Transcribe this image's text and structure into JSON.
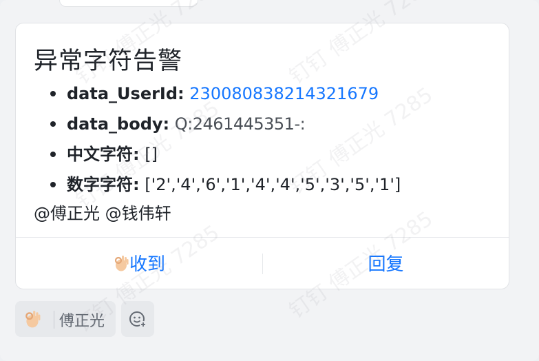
{
  "card": {
    "title": "异常字符告警",
    "fields": [
      {
        "key": "data_UserId:",
        "value": "230080838214321679",
        "style": "link"
      },
      {
        "key": "data_body:",
        "value": "Q:2461445351-:",
        "style": "obscured"
      },
      {
        "key": "中文字符:",
        "value": "[]",
        "style": "plain"
      },
      {
        "key": "数字字符:",
        "value": "['2','4','6','1','4','4','5','3','5','1']",
        "style": "plain"
      }
    ],
    "mentions": "@傅正光 @钱伟轩",
    "actions": {
      "ack_label": "收到",
      "reply_label": "回复"
    }
  },
  "reaction": {
    "icon": "ok-hand-icon",
    "user": "傅正光"
  },
  "add_reaction_icon": "add-emoji-icon",
  "watermark": "钉钉 傅正光 7285",
  "colors": {
    "link": "#1677ff",
    "text": "#1f2329",
    "muted": "#646a73"
  }
}
